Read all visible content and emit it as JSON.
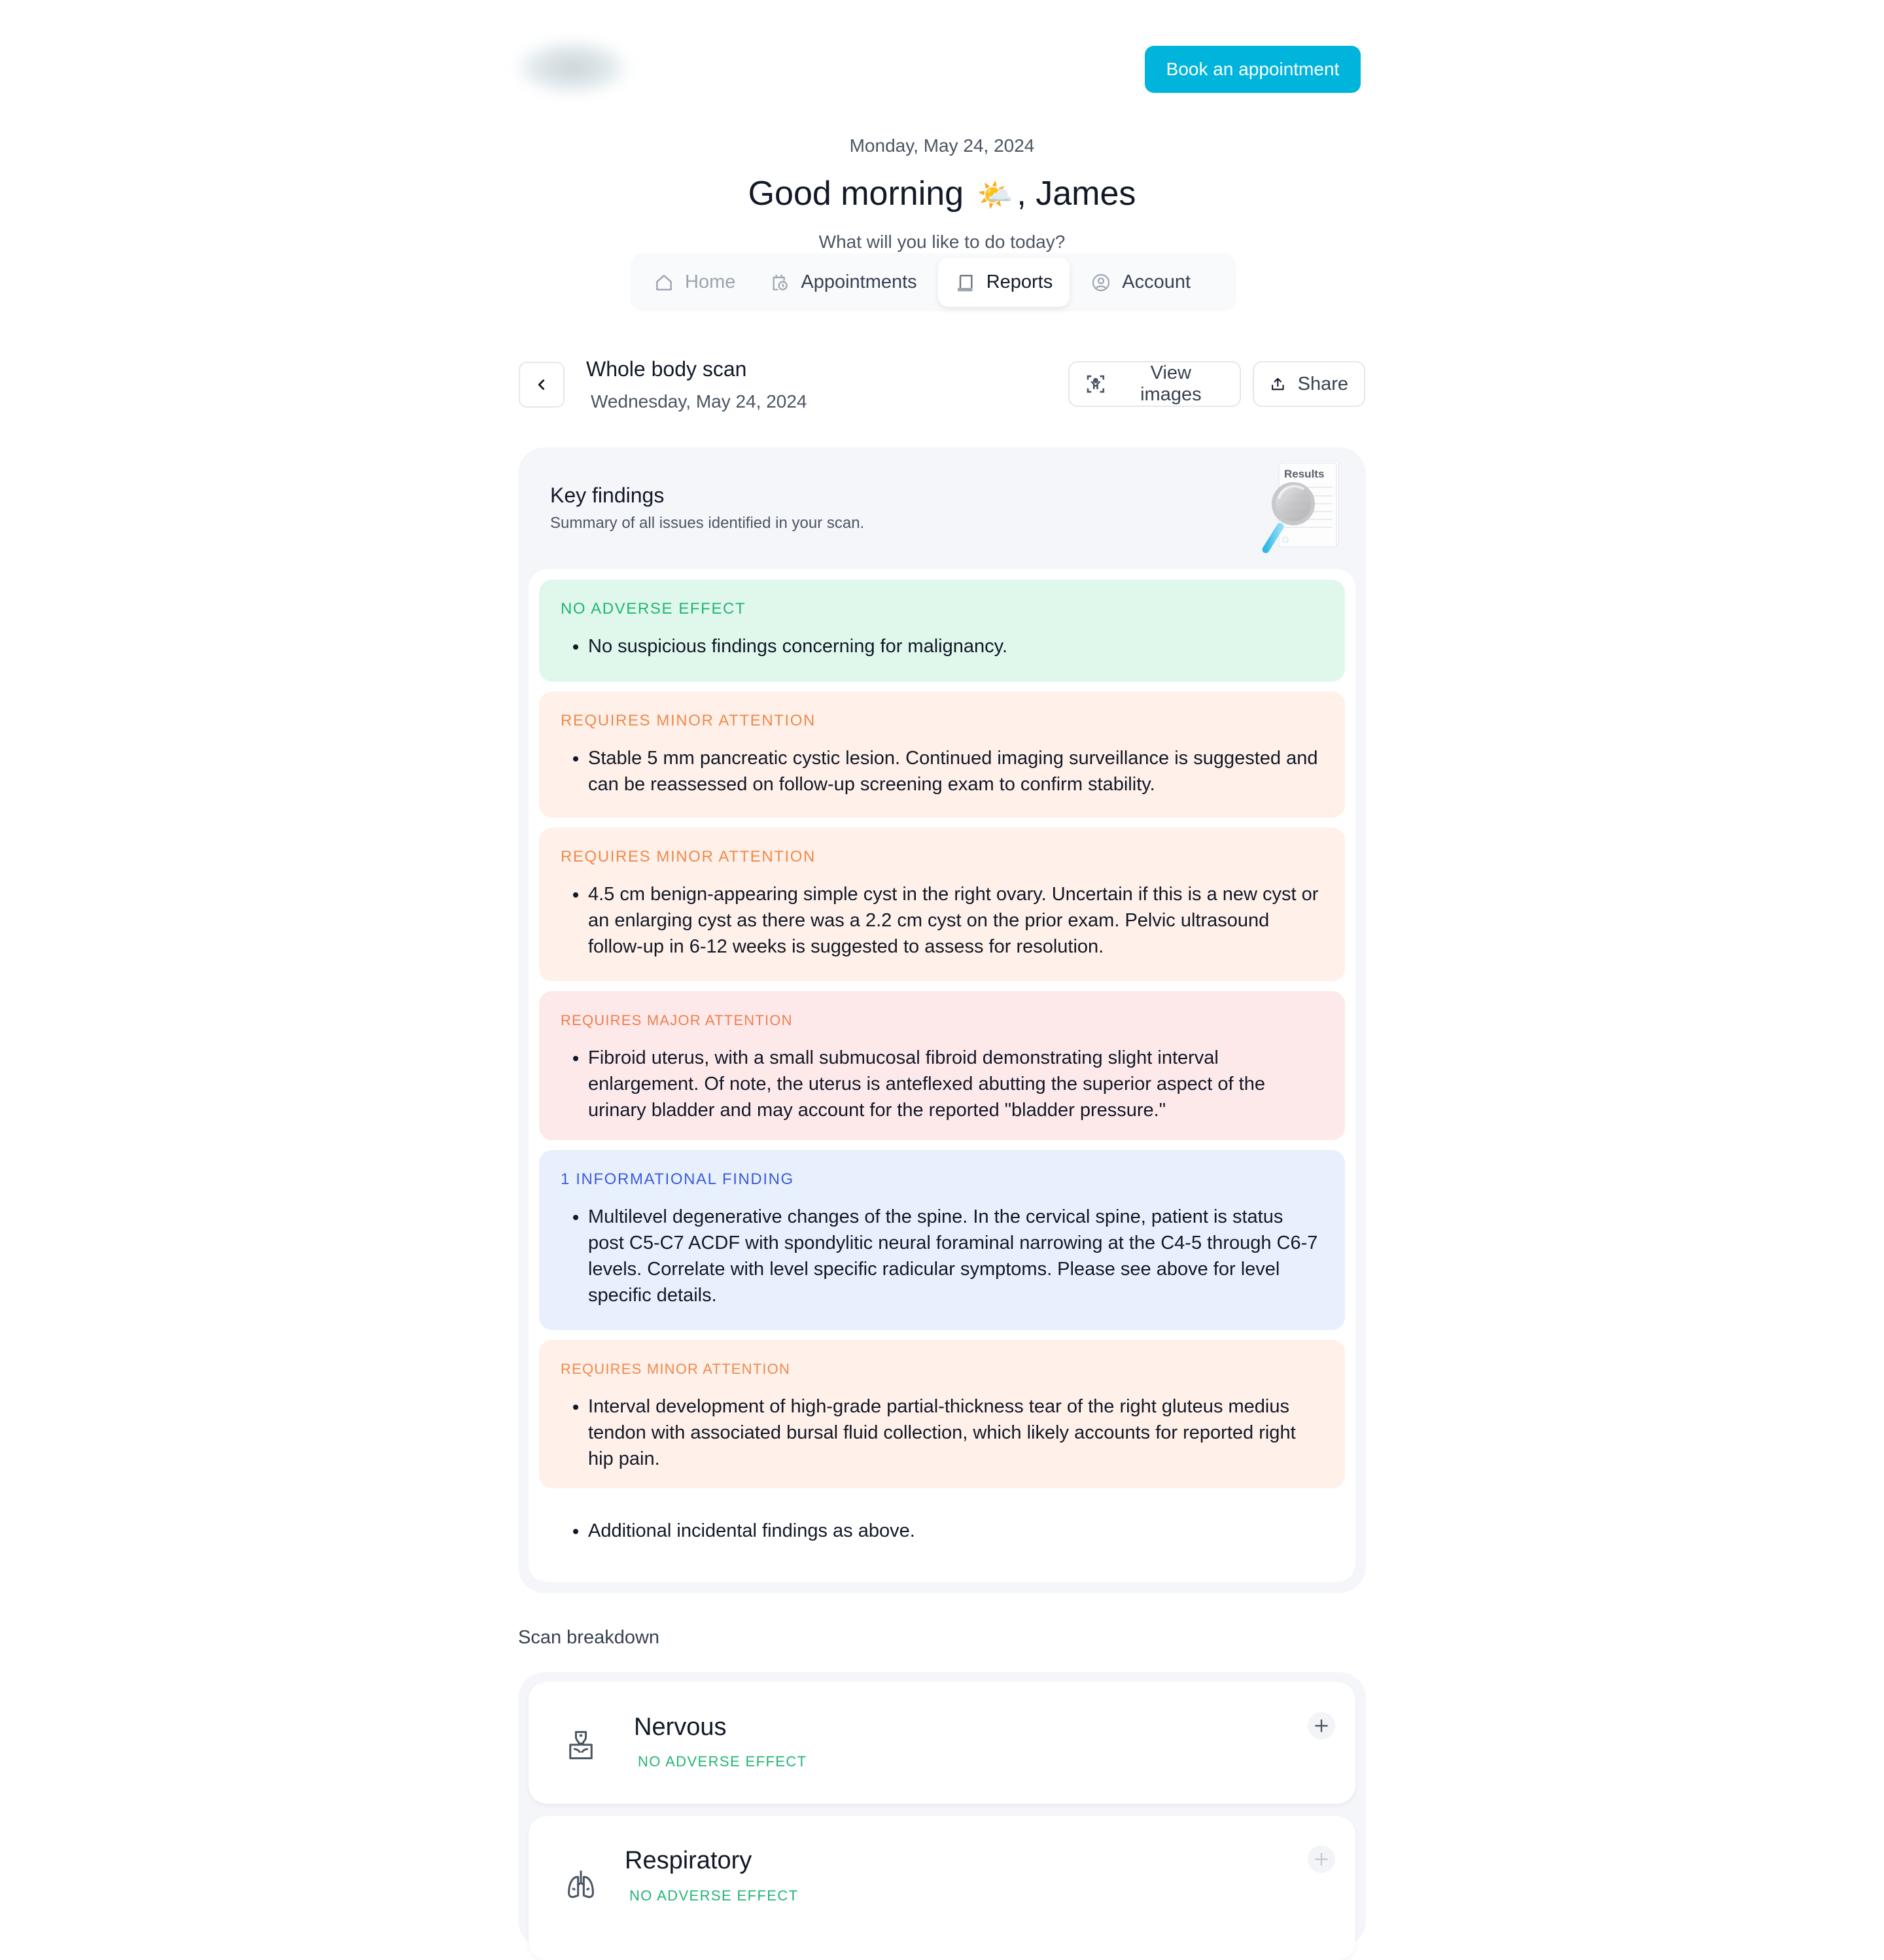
{
  "header": {
    "logo_alt": "blurred-logo",
    "book_button": "Book an appointment",
    "date": "Monday, May 24, 2024",
    "greeting_prefix": "Good morning",
    "greeting_emoji": "🌤️",
    "greeting_suffix": ", James",
    "subtitle": "What will you like to do today?"
  },
  "tabs": [
    {
      "label": "Home",
      "icon": "home-icon",
      "active": false
    },
    {
      "label": "Appointments",
      "icon": "calendar-clock-icon",
      "active": false
    },
    {
      "label": "Reports",
      "icon": "report-icon",
      "active": true
    },
    {
      "label": "Account",
      "icon": "user-circle-icon",
      "active": false
    }
  ],
  "report": {
    "title": "Whole body scan",
    "date": "Wednesday, May 24, 2024",
    "view_images": "View images",
    "share": "Share"
  },
  "key_findings": {
    "title": "Key findings",
    "subtitle": "Summary of all issues identified in your scan.",
    "illustration_text": "Results",
    "items": [
      {
        "status": "NO ADVERSE EFFECT",
        "level": "green",
        "text": "No suspicious findings concerning for malignancy."
      },
      {
        "status": "REQUIRES MINOR ATTENTION",
        "level": "orange",
        "text": "Stable 5 mm pancreatic cystic lesion. Continued imaging surveillance is suggested and can be reassessed on follow-up screening exam to confirm stability."
      },
      {
        "status": "REQUIRES MINOR ATTENTION",
        "level": "orange",
        "text": "4.5 cm benign-appearing simple cyst in the right ovary. Uncertain if this is a new cyst or an enlarging cyst as there was a 2.2 cm cyst on the prior exam. Pelvic ultrasound follow-up in 6-12 weeks is suggested to assess for resolution."
      },
      {
        "status": "REQUIRES MAJOR ATTENTION",
        "level": "red",
        "text": "Fibroid uterus, with a small submucosal fibroid demonstrating slight interval enlargement. Of note, the uterus is anteflexed abutting the superior aspect of the urinary bladder and may account for the reported \"bladder pressure.\""
      },
      {
        "status": "1 INFORMATIONAL FINDING",
        "level": "blue",
        "text": "Multilevel degenerative changes of the spine. In the cervical spine, patient is status post C5-C7 ACDF with spondylitic neural foraminal narrowing at the C4-5 through C6-7 levels. Correlate with level specific radicular symptoms. Please see above for level specific details."
      },
      {
        "status": "REQUIRES MINOR ATTENTION",
        "level": "orange",
        "text": "Interval development of high-grade partial-thickness tear of the right gluteus medius tendon with associated bursal fluid collection, which likely accounts for reported right hip pain."
      }
    ],
    "additional": "Additional incidental findings as above."
  },
  "scan_breakdown": {
    "label": "Scan breakdown",
    "systems": [
      {
        "name": "Nervous",
        "status": "NO ADVERSE EFFECT",
        "icon": "nervous-system-icon"
      },
      {
        "name": "Respiratory",
        "status": "NO ADVERSE EFFECT",
        "icon": "lungs-icon"
      }
    ]
  },
  "colors": {
    "accent": "#00B4DB",
    "green": "#22B573",
    "orange": "#F08A4B",
    "blue": "#3B5BDB",
    "green_bg": "#E0F8EC",
    "orange_bg": "#FFF0E9",
    "red_bg": "#FEE9EA",
    "blue_bg": "#E8F0FD"
  }
}
